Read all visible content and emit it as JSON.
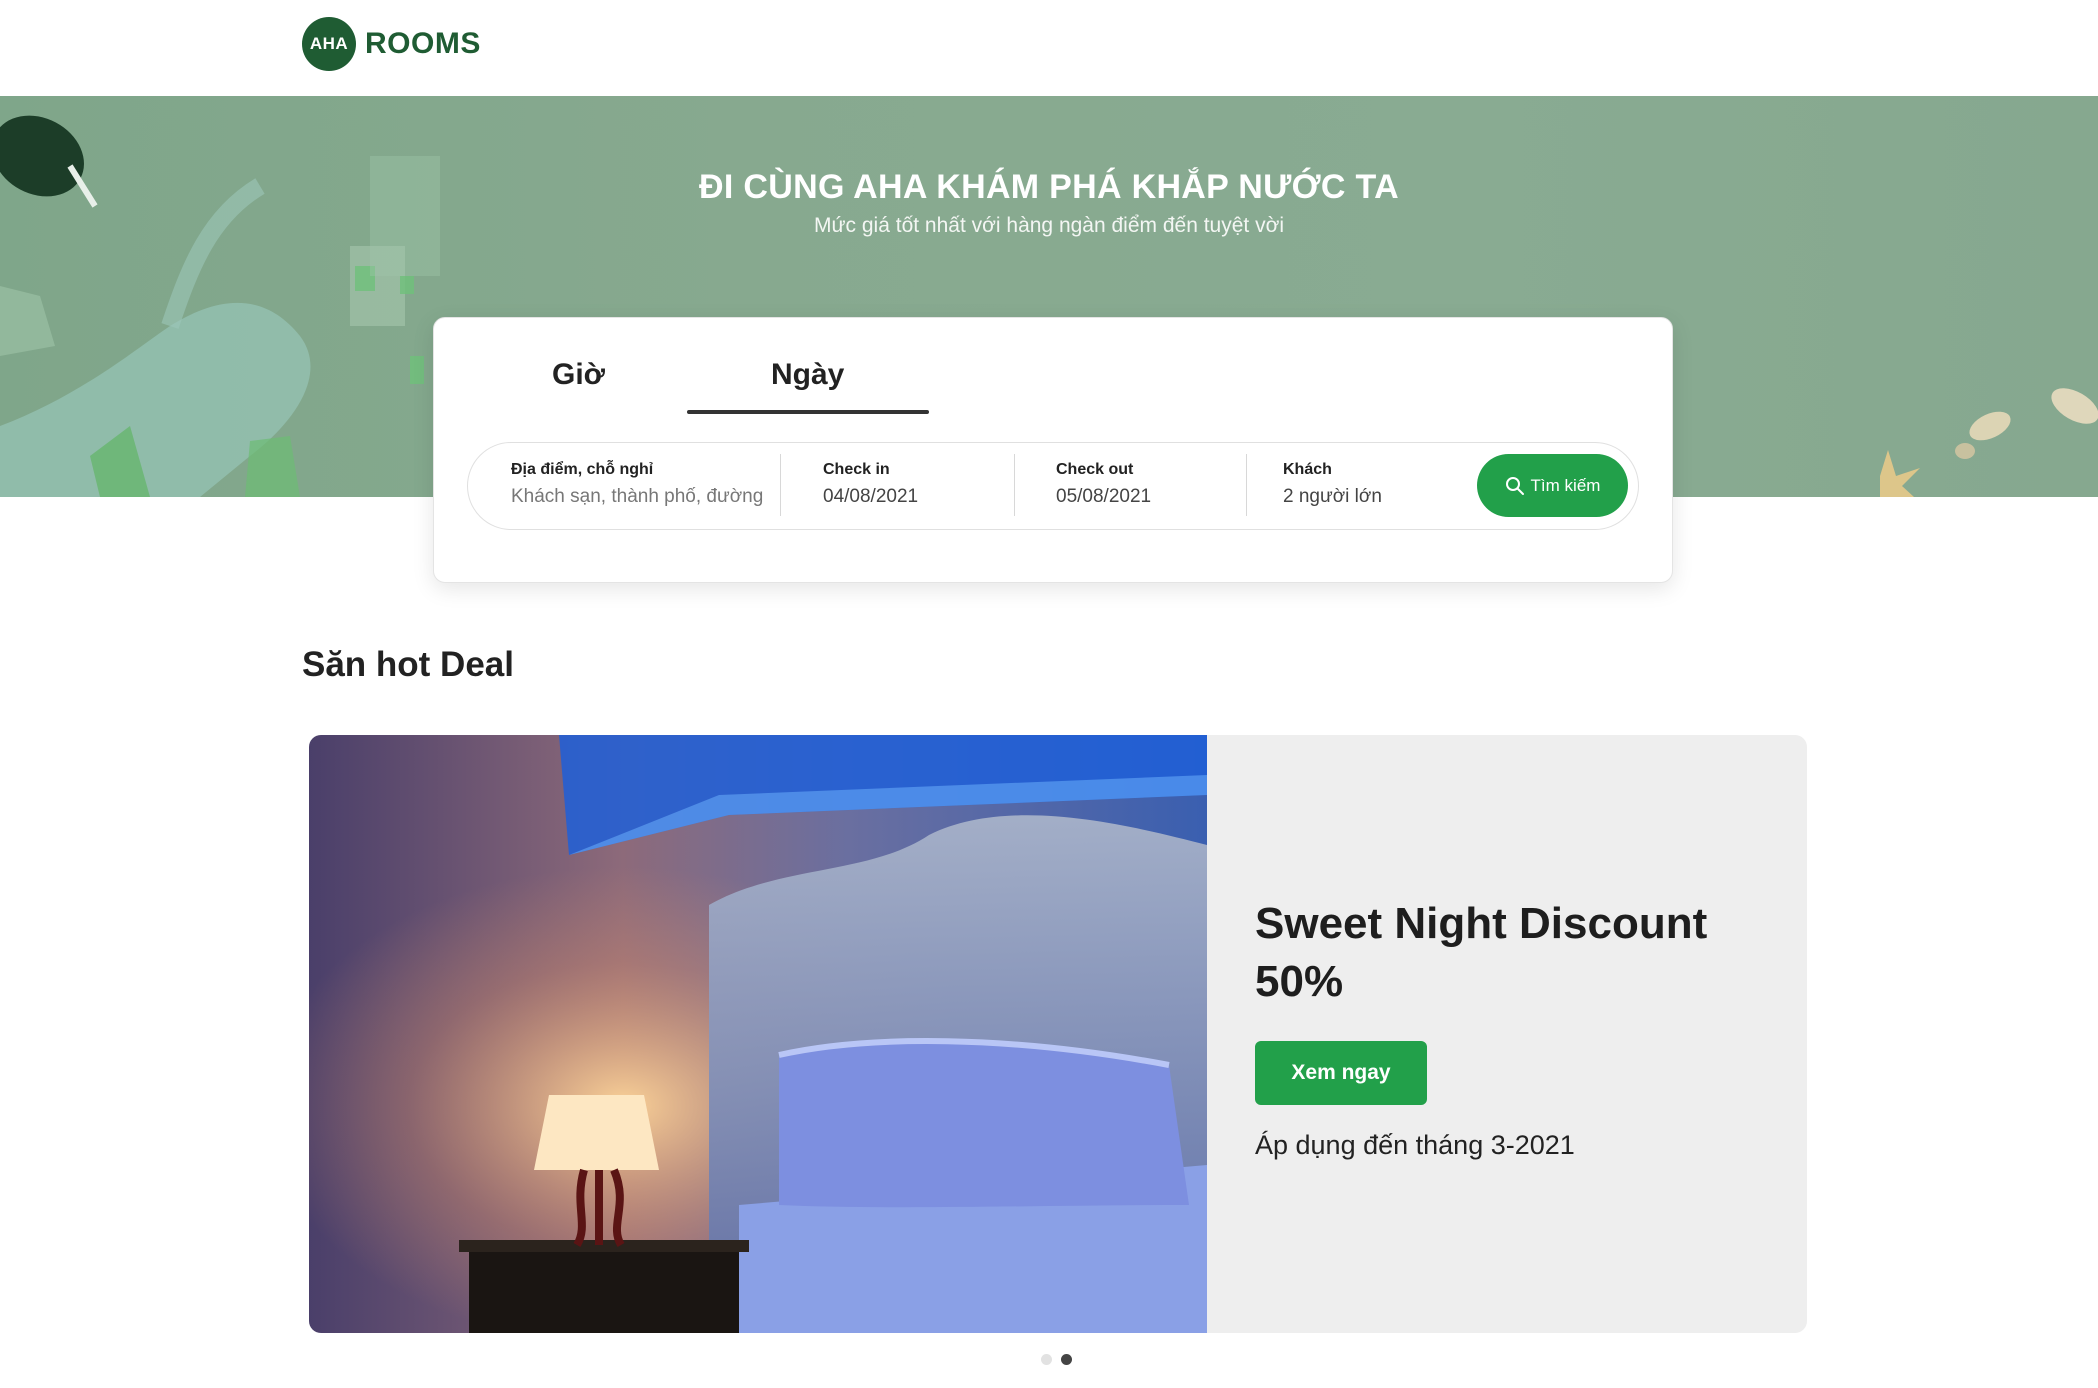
{
  "brand": {
    "badge": "AHA",
    "name": "ROOMS",
    "color": "#1f5c33"
  },
  "hero": {
    "title": "ĐI CÙNG AHA KHÁM PHÁ KHẮP NƯỚC TA",
    "subtitle": "Mức giá tốt nhất với hàng ngàn điểm đến tuyệt vời"
  },
  "search": {
    "tabs": [
      {
        "label": "Giờ",
        "active": false
      },
      {
        "label": "Ngày",
        "active": true
      }
    ],
    "fields": [
      {
        "label": "Địa điểm, chỗ nghỉ",
        "placeholder": "Khách sạn, thành phố, đường"
      },
      {
        "label": "Check in",
        "value": "04/08/2021"
      },
      {
        "label": "Check out",
        "value": "05/08/2021"
      },
      {
        "label": "Khách",
        "value": "2 người lớn"
      }
    ],
    "button_label": "Tìm kiếm",
    "button_icon": "search-icon"
  },
  "deals": {
    "section_title": "Săn hot Deal",
    "card": {
      "title": "Sweet Night Discount 50%",
      "button_label": "Xem ngay",
      "note": "Áp dụng đến tháng 3-2021"
    },
    "carousel": {
      "count": 2,
      "active_index": 1
    }
  },
  "colors": {
    "accent": "#22a04a",
    "hero_bg": "#86a88f",
    "card_bg": "#eeeeee"
  }
}
